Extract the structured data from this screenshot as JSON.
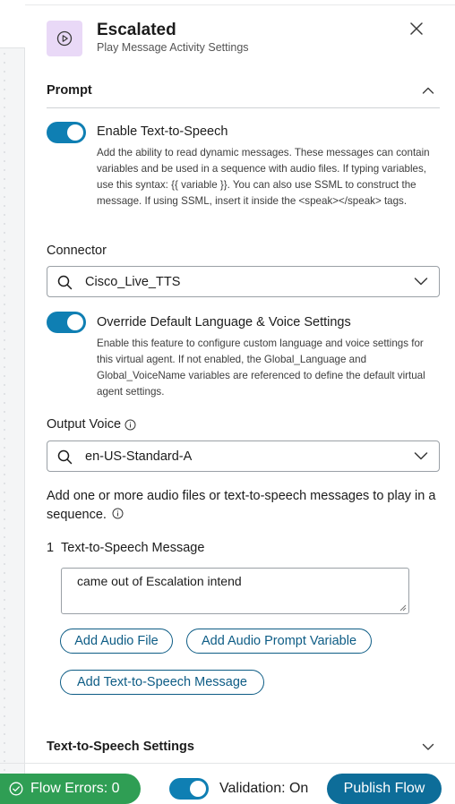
{
  "header": {
    "title": "Escalated",
    "subtitle": "Play Message Activity Settings",
    "icon": "play-circle-icon"
  },
  "prompt_section": {
    "label": "Prompt",
    "tts_toggle": {
      "label": "Enable Text-to-Speech",
      "on": true,
      "description": "Add the ability to read dynamic messages. These messages can contain variables and be used in a sequence with audio files. If typing variables, use this syntax: {{ variable }}. You can also use SSML to construct the message. If using SSML, insert it inside the <speak></speak> tags."
    },
    "connector": {
      "label": "Connector",
      "value": "Cisco_Live_TTS"
    },
    "override_toggle": {
      "label": "Override Default Language & Voice Settings",
      "on": true,
      "description": "Enable this feature to configure custom language and voice settings for this virtual agent. If not enabled, the Global_Language and Global_VoiceName variables are referenced to define the default virtual agent settings."
    },
    "output_voice": {
      "label": "Output Voice",
      "value": "en-US-Standard-A"
    },
    "sequence_text": "Add one or more audio files or text-to-speech messages to play in a sequence.",
    "messages": [
      {
        "index": "1",
        "label": "Text-to-Speech Message",
        "value": "came out of Escalation intend"
      }
    ],
    "buttons": {
      "add_audio_file": "Add Audio File",
      "add_audio_prompt_variable": "Add Audio Prompt Variable",
      "add_tts_message": "Add Text-to-Speech Message"
    }
  },
  "tts_settings_section": {
    "label": "Text-to-Speech Settings"
  },
  "footer": {
    "flow_errors": "Flow Errors: 0",
    "validation_label": "Validation: On",
    "validation_on": true,
    "publish_label": "Publish Flow"
  },
  "colors": {
    "accent": "#0f7fb3",
    "publish": "#0d6d99",
    "success": "#2f9e54",
    "icon_bg": "#e9d9f7"
  }
}
